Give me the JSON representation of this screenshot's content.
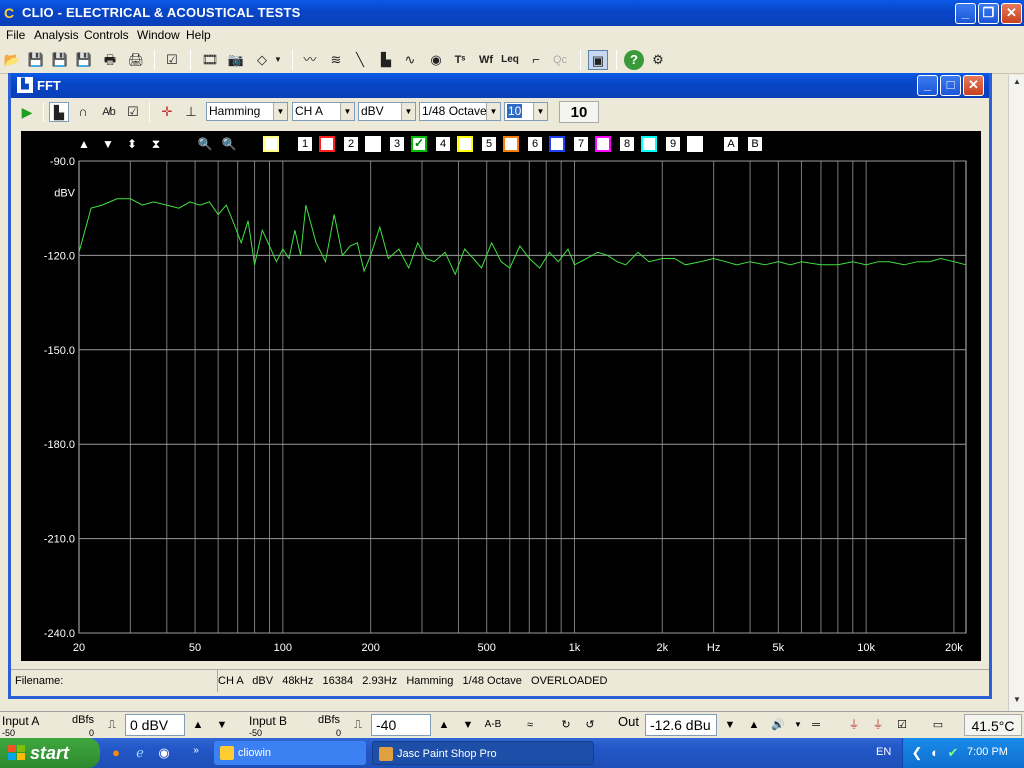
{
  "app": {
    "title": "CLIO - ELECTRICAL & ACOUSTICAL TESTS",
    "minimize": "_",
    "restore": "❐",
    "close": "✕"
  },
  "menu": [
    "File",
    "Analysis",
    "Controls",
    "Window",
    "Help"
  ],
  "fft_window": {
    "title": "FFT",
    "window_type": "Hamming",
    "channel": "CH A",
    "unit": "dBV",
    "smoothing": "1/48 Octave",
    "averages_select": "10",
    "averages_display": "10"
  },
  "overlay_toolbar": {
    "numbers": [
      "1",
      "2",
      "3",
      "4",
      "5",
      "6",
      "7",
      "8",
      "9"
    ],
    "ab": [
      "A",
      "B"
    ],
    "colors": [
      "#ff2020",
      "#ffffff",
      "#00c000",
      "#ffff00",
      "#ff8000",
      "#2040ff",
      "#ff00ff",
      "#00ffff",
      "#ffffff"
    ]
  },
  "chart_data": {
    "type": "line",
    "yunit_label": "dBV",
    "xunit_label": "Hz",
    "ylim": [
      -240,
      -90
    ],
    "xlim": [
      20,
      22000
    ],
    "x_scale": "log",
    "y_ticks": [
      "-90.0",
      "-120.0",
      "-150.0",
      "-180.0",
      "-210.0",
      "-240.0"
    ],
    "y_tick_values": [
      -90,
      -120,
      -150,
      -180,
      -210,
      -240
    ],
    "x_ticks": [
      "20",
      "50",
      "100",
      "200",
      "500",
      "1k",
      "2k",
      "5k",
      "10k",
      "20k"
    ],
    "x_tick_values": [
      20,
      50,
      100,
      200,
      500,
      1000,
      2000,
      5000,
      10000,
      20000
    ],
    "grid": true,
    "series_color": "#40e040",
    "series": [
      {
        "x": [
          20,
          22,
          24,
          27,
          30,
          33,
          36,
          40,
          44,
          48,
          52,
          56,
          60,
          64,
          68,
          72,
          76,
          80,
          85,
          90,
          95,
          100,
          105,
          110,
          115,
          120,
          130,
          140,
          150,
          160,
          170,
          180,
          190,
          200,
          215,
          230,
          250,
          270,
          290,
          310,
          330,
          360,
          390,
          420,
          450,
          480,
          520,
          560,
          600,
          650,
          700,
          760,
          820,
          880,
          950,
          1000,
          1100,
          1200,
          1300,
          1400,
          1500,
          1650,
          1800,
          2000,
          2200,
          2400,
          2700,
          3000,
          3300,
          3600,
          4000,
          4500,
          5000,
          5500,
          6000,
          7000,
          8000,
          9000,
          10000,
          11000,
          12000,
          13500,
          15000,
          16500,
          18000,
          20000,
          22000
        ],
        "y": [
          -119,
          -105,
          -104,
          -102,
          -102,
          -104,
          -103,
          -104,
          -105,
          -103,
          -104,
          -103,
          -107,
          -104,
          -110,
          -116,
          -109,
          -123,
          -112,
          -117,
          -122,
          -118,
          -121,
          -112,
          -120,
          -104,
          -116,
          -122,
          -107,
          -120,
          -117,
          -116,
          -125,
          -120,
          -111,
          -121,
          -118,
          -124,
          -116,
          -121,
          -122,
          -119,
          -126,
          -118,
          -121,
          -124,
          -116,
          -122,
          -124,
          -117,
          -121,
          -124,
          -119,
          -122,
          -118,
          -123,
          -121,
          -119,
          -120,
          -122,
          -123,
          -119,
          -122,
          -121,
          -121,
          -123,
          -122,
          -121,
          -122,
          -123,
          -122,
          -123,
          -122,
          -123,
          -122,
          -123,
          -123,
          -122,
          -123,
          -122,
          -122,
          -123,
          -122,
          -122,
          -121,
          -122,
          -123
        ]
      }
    ]
  },
  "status": {
    "filename_label": "Filename:",
    "info": "CH A   dBV   48kHz   16384   2.93Hz   Hamming   1/48 Octave   OVERLOADED"
  },
  "io": {
    "input_a_label": "Input A",
    "input_a_unit": "dBfs",
    "input_a_min": "-50",
    "input_a_max": "0",
    "input_a_value": "0 dBV",
    "input_b_label": "Input B",
    "input_b_unit": "dBfs",
    "input_b_min": "-50",
    "input_b_max": "0",
    "input_b_value": "-40 dBV",
    "ab_label": "A-B",
    "out_label": "Out",
    "out_value": "-12.6 dBu",
    "temperature": "41.5°C"
  },
  "taskbar": {
    "start": "start",
    "tasks": [
      "cliowin",
      "Jasc Paint Shop Pro"
    ],
    "language": "EN",
    "time": "7:00 PM"
  }
}
